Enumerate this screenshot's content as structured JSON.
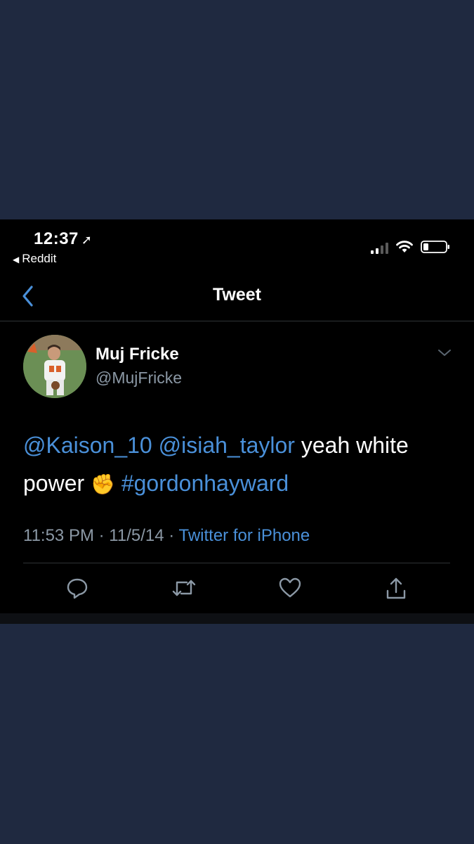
{
  "status_bar": {
    "time": "12:37",
    "location_glyph": "➚",
    "back_app": "Reddit",
    "back_glyph": "◀",
    "icons": [
      "signal-icon",
      "wifi-icon",
      "battery-icon"
    ]
  },
  "nav": {
    "title": "Tweet",
    "back_icon": "chevron-left-icon"
  },
  "tweet": {
    "display_name": "Muj Fricke",
    "handle": "@MujFricke",
    "text_parts": {
      "mention1": "@Kaison_10",
      "mention2": "@isiah_taylor",
      "plain1": "yeah white power",
      "emoji": "✊",
      "hashtag": "#gordonhayward"
    },
    "time": "11:53 PM",
    "date": "11/5/14",
    "separator": "·",
    "source": "Twitter for iPhone"
  },
  "actions": [
    "reply-icon",
    "retweet-icon",
    "like-icon",
    "share-icon"
  ],
  "colors": {
    "background": "#1f2940",
    "screen": "#000000",
    "link": "#4a90d9",
    "secondary_text": "#8b98a5"
  }
}
